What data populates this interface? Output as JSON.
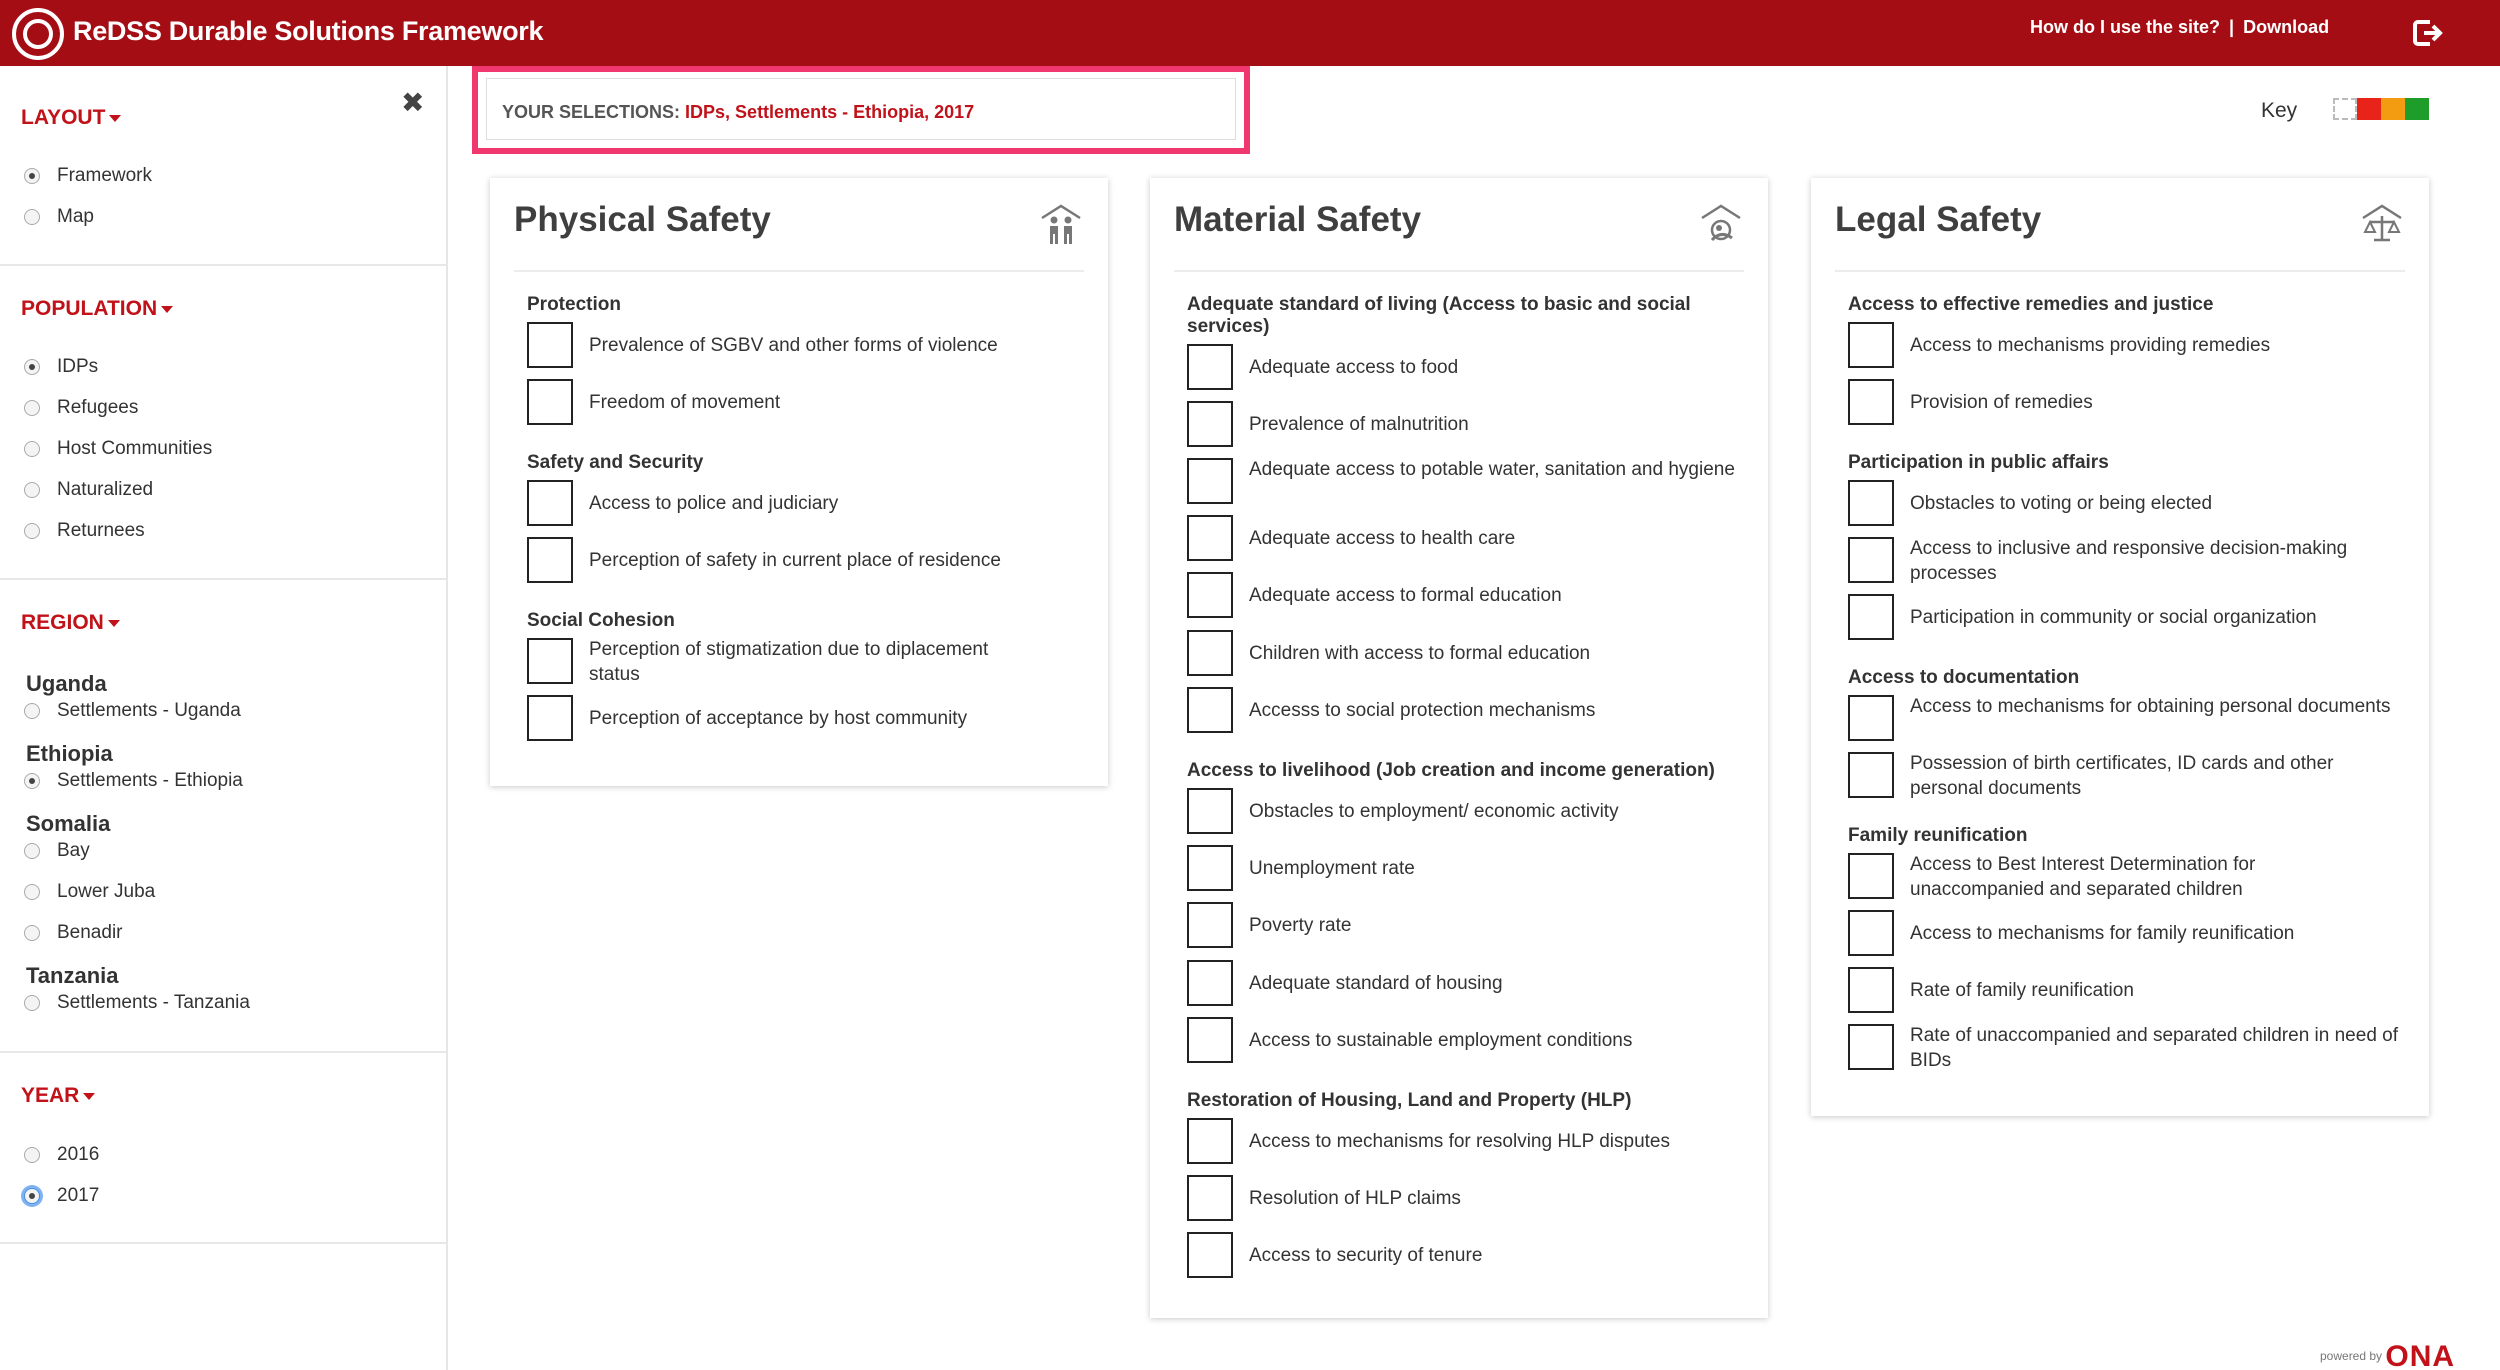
{
  "header": {
    "title": "ReDSS Durable Solutions Framework",
    "help": "How do I use the site?",
    "separator": "|",
    "download": "Download"
  },
  "sidebar": {
    "layout": {
      "title": "LAYOUT",
      "options": [
        {
          "label": "Framework",
          "selected": true
        },
        {
          "label": "Map",
          "selected": false
        }
      ]
    },
    "population": {
      "title": "POPULATION",
      "options": [
        {
          "label": "IDPs",
          "selected": true
        },
        {
          "label": "Refugees",
          "selected": false
        },
        {
          "label": "Host Communities",
          "selected": false
        },
        {
          "label": "Naturalized",
          "selected": false
        },
        {
          "label": "Returnees",
          "selected": false
        }
      ]
    },
    "region": {
      "title": "REGION",
      "countries": [
        {
          "name": "Uganda",
          "options": [
            "Settlements - Uganda"
          ]
        },
        {
          "name": "Ethiopia",
          "options": [
            "Settlements - Ethiopia"
          ]
        },
        {
          "name": "Somalia",
          "options": [
            "Bay",
            "Lower Juba",
            "Benadir"
          ]
        },
        {
          "name": "Tanzania",
          "options": [
            "Settlements - Tanzania"
          ]
        }
      ],
      "selected": "Settlements - Ethiopia"
    },
    "year": {
      "title": "YEAR",
      "options": [
        {
          "label": "2016",
          "selected": false
        },
        {
          "label": "2017",
          "selected": true
        }
      ]
    }
  },
  "selections": {
    "label": "YOUR SELECTIONS:",
    "value": "IDPs, Settlements - Ethiopia, 2017"
  },
  "key": {
    "label": "Key",
    "colors": [
      "#ffffff",
      "#e8231a",
      "#f39c12",
      "#1f9d2b"
    ]
  },
  "panels": {
    "physical": {
      "title": "Physical Safety",
      "icon": "people-icon",
      "groups": [
        {
          "title": "Protection",
          "items": [
            "Prevalence of SGBV and other forms of violence",
            "Freedom of movement"
          ]
        },
        {
          "title": "Safety and Security",
          "items": [
            "Access to police and judiciary",
            "Perception of safety in current place of residence"
          ]
        },
        {
          "title": "Social Cohesion",
          "items": [
            "Perception of stigmatization due to diplacement status",
            "Perception of acceptance by host community"
          ]
        }
      ]
    },
    "material": {
      "title": "Material Safety",
      "icon": "shelter-icon",
      "groups": [
        {
          "title": "Adequate standard of living (Access to basic and social services)",
          "items": [
            "Adequate access to food",
            "Prevalence of malnutrition",
            "Adequate access to potable water, sanitation and hygiene",
            "Adequate access to health care",
            "Adequate access to formal education",
            "Children with access to formal education",
            "Accesss to social protection mechanisms"
          ]
        },
        {
          "title": "Access to livelihood (Job creation and income generation)",
          "items": [
            "Obstacles to employment/ economic activity",
            "Unemployment rate",
            "Poverty rate",
            "Adequate standard of housing",
            "Access to sustainable employment conditions"
          ]
        },
        {
          "title": "Restoration of Housing, Land and Property (HLP)",
          "items": [
            "Access to mechanisms for resolving HLP disputes",
            "Resolution of HLP claims",
            "Access to security of tenure"
          ]
        }
      ]
    },
    "legal": {
      "title": "Legal Safety",
      "icon": "scales-icon",
      "groups": [
        {
          "title": "Access to effective remedies and justice",
          "items": [
            "Access to mechanisms providing remedies",
            "Provision of remedies"
          ]
        },
        {
          "title": "Participation in public affairs",
          "items": [
            "Obstacles to voting or being elected",
            "Access to inclusive and responsive decision-making processes",
            "Participation in community or social organization"
          ]
        },
        {
          "title": "Access to documentation",
          "items": [
            "Access to mechanisms for obtaining personal documents",
            "Possession of birth certificates, ID cards and other personal documents"
          ]
        },
        {
          "title": "Family reunification",
          "items": [
            "Access to Best Interest Determination for unaccompanied and separated children",
            "Access to mechanisms for family reunification",
            "Rate of family reunification",
            "Rate of unaccompanied and separated children in need of BIDs"
          ]
        }
      ]
    }
  },
  "footer": {
    "powered": "powered by",
    "brand": "ONA"
  }
}
